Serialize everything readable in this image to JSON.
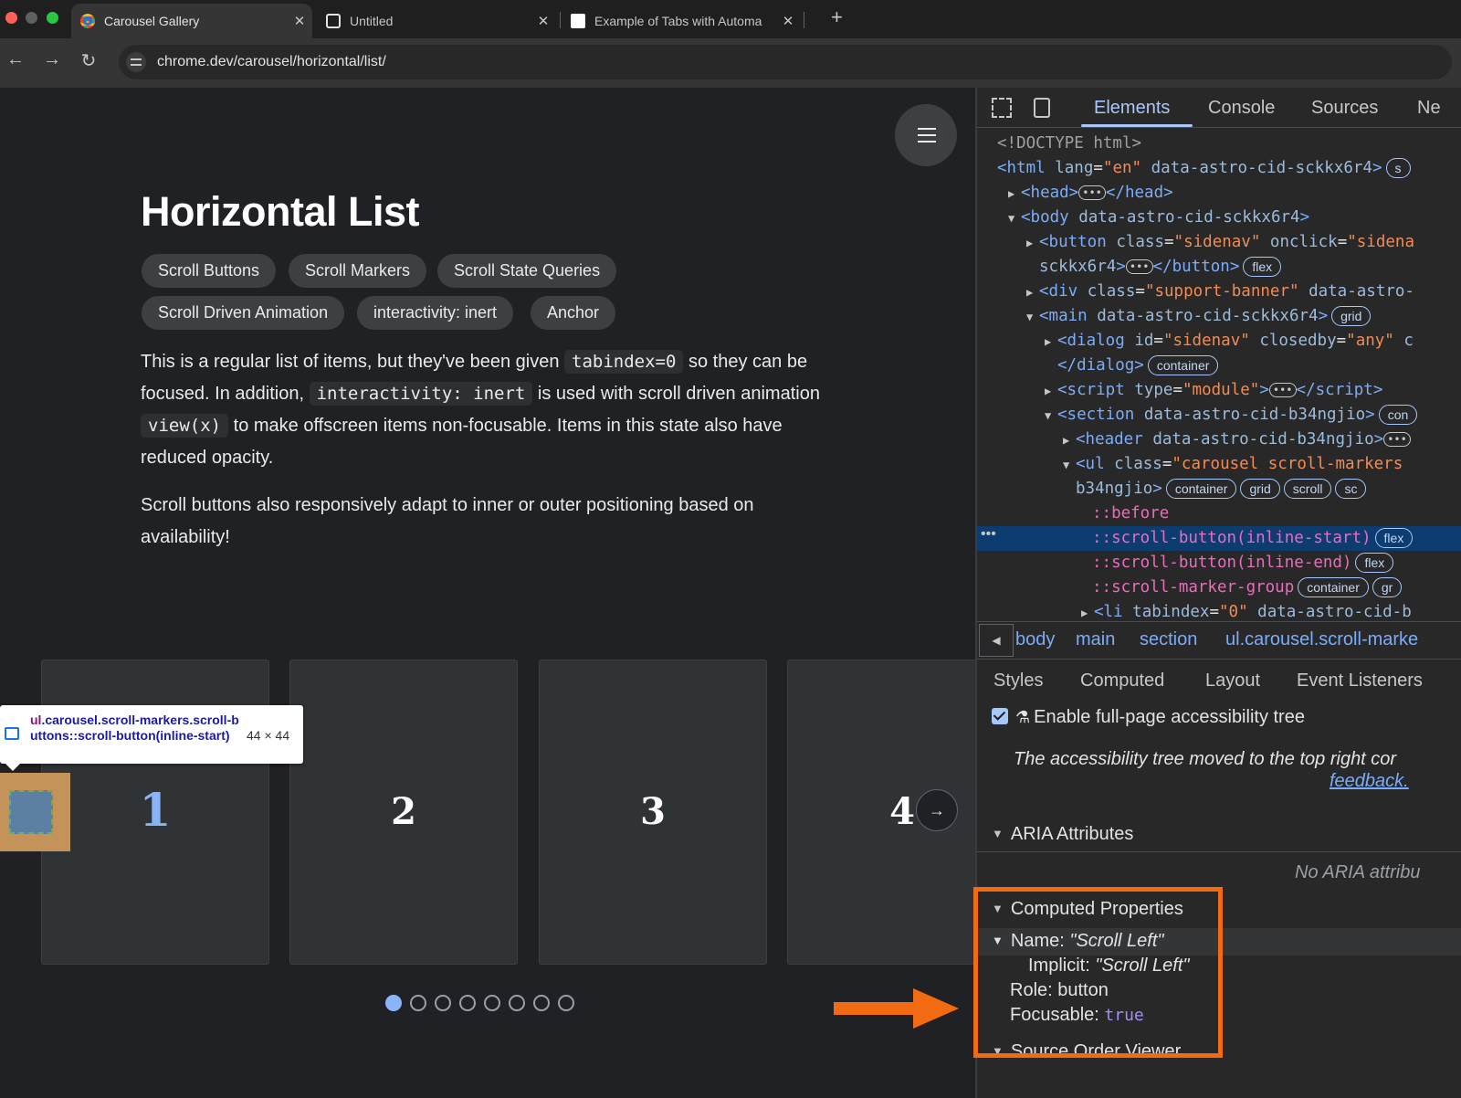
{
  "browser": {
    "tabs": [
      {
        "title": "Carousel Gallery",
        "active": true,
        "close": "✕"
      },
      {
        "title": "Untitled",
        "active": false,
        "close": "✕"
      },
      {
        "title": "Example of Tabs with Automa",
        "active": false,
        "close": "✕"
      }
    ],
    "new_tab": "+",
    "url": "chrome.dev/carousel/horizontal/list/",
    "nav": {
      "back": "←",
      "forward": "→",
      "reload": "↻"
    }
  },
  "page": {
    "title": "Horizontal List",
    "chips": [
      "Scroll Buttons",
      "Scroll Markers",
      "Scroll State Queries",
      "Scroll Driven Animation",
      "interactivity: inert",
      "Anchor"
    ],
    "para1": {
      "t1": "This is a regular list of items, but they've been given ",
      "c1": "tabindex=0",
      "t2": " so they can be focused. In addition, ",
      "c2": "interactivity: inert",
      "t3": " is used with scroll driven animation ",
      "c3": "view(x)",
      "t4": " to make offscreen items non-focusable. Items in this state also have reduced opacity."
    },
    "para2": "Scroll buttons also responsively adapt to inner or outer positioning based on availability!",
    "cards": [
      "1",
      "2",
      "3",
      "4"
    ],
    "next_arrow": "→",
    "marker_dots": 8,
    "active_marker": 1
  },
  "inspect_tooltip": {
    "tag": "ul",
    "selector": ".carousel.scroll-markers.scroll-buttons::scroll-button(inline-start)",
    "size": "44 × 44"
  },
  "devtools": {
    "tabs": [
      "Elements",
      "Console",
      "Sources",
      "Ne"
    ],
    "active_tab": "Elements",
    "breadcrumbs": [
      "body",
      "main",
      "section",
      "ul.carousel.scroll-marke"
    ],
    "sub_tabs": [
      "Styles",
      "Computed",
      "Layout",
      "Event Listeners"
    ],
    "a11y_toggle": "Enable full-page accessibility tree",
    "a11y_message": "The accessibility tree moved to the top right cor",
    "a11y_feedback": "feedback.",
    "aria_header": "ARIA Attributes",
    "no_aria": "No ARIA attribu",
    "computed_header": "Computed Properties",
    "name_label": "Name: ",
    "name_value": "\"Scroll Left\"",
    "implicit_label": "Implicit: ",
    "implicit_value": "\"Scroll Left\"",
    "role_label": "Role: ",
    "role_value": "button",
    "focusable_label": "Focusable: ",
    "focusable_value": "true",
    "source_order_header": "Source Order Viewer"
  },
  "colors": {
    "accent": "#a8c7fa",
    "annotation": "#f26a12",
    "marker_active": "#8ab4f8"
  }
}
